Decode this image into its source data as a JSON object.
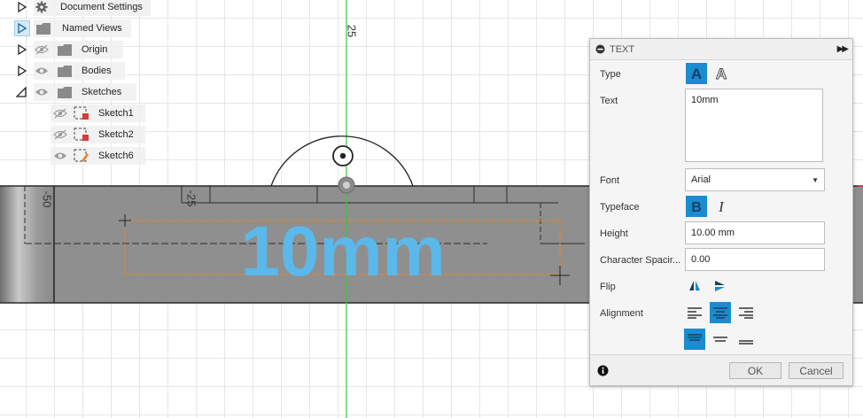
{
  "browser": {
    "items": [
      {
        "label": "Document Settings"
      },
      {
        "label": "Named Views"
      },
      {
        "label": "Origin"
      },
      {
        "label": "Bodies"
      },
      {
        "label": "Sketches"
      },
      {
        "label": "Sketch1"
      },
      {
        "label": "Sketch2"
      },
      {
        "label": "Sketch6"
      }
    ]
  },
  "viewport": {
    "ruler_labels": [
      "25",
      "-50",
      "-25"
    ],
    "sketch_text": "10mm",
    "colors": {
      "body": "#8f8f8f",
      "sketch_text": "#5ab8ea",
      "axis": "#3cc43c",
      "selection": "#e8832a"
    }
  },
  "dialog": {
    "title": "TEXT",
    "type_label": "Type",
    "text_label": "Text",
    "text_value": "10mm",
    "font_label": "Font",
    "font_value": "Arial",
    "typeface_label": "Typeface",
    "height_label": "Height",
    "height_value": "10.00 mm",
    "char_spacing_label": "Character Spacir...",
    "char_spacing_value": "0.00",
    "flip_label": "Flip",
    "alignment_label": "Alignment",
    "ok_label": "OK",
    "cancel_label": "Cancel",
    "accent": "#1a8ccf"
  }
}
